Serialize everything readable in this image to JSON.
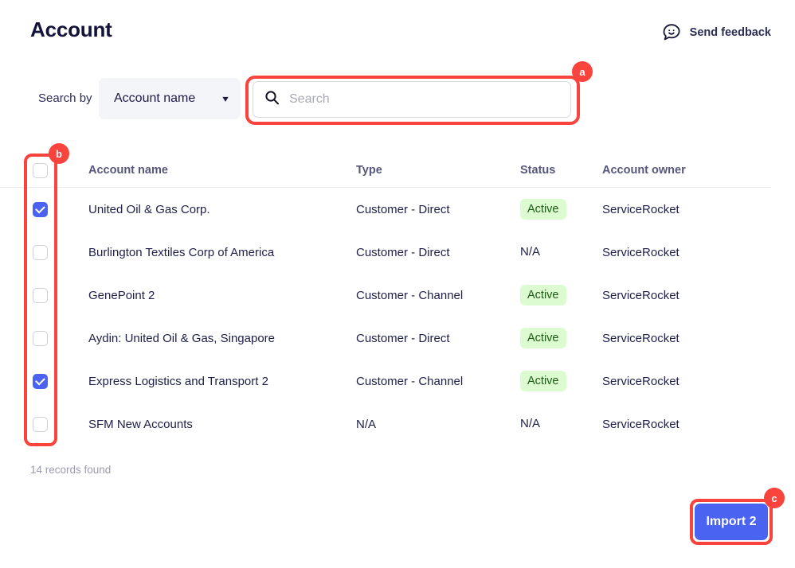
{
  "header": {
    "title": "Account",
    "feedback_label": "Send feedback",
    "feedback_icon": "speech-bubble-smiley-icon"
  },
  "search": {
    "search_by_label": "Search by",
    "selected_field": "Account name",
    "chevron_icon": "chevron-down-icon",
    "search_icon": "search-icon",
    "placeholder": "Search",
    "value": ""
  },
  "annotations": [
    {
      "id": "a",
      "target": "search-input"
    },
    {
      "id": "b",
      "target": "row-checkbox-column"
    },
    {
      "id": "c",
      "target": "import-button"
    }
  ],
  "table": {
    "columns": [
      "Account name",
      "Type",
      "Status",
      "Account owner"
    ],
    "select_all_checked": false,
    "rows": [
      {
        "checked": true,
        "name": "United Oil & Gas Corp.",
        "type": "Customer - Direct",
        "status": "Active",
        "status_style": "pill",
        "owner": "ServiceRocket"
      },
      {
        "checked": false,
        "name": "Burlington Textiles Corp of America",
        "type": "Customer - Direct",
        "status": "N/A",
        "status_style": "plain",
        "owner": "ServiceRocket"
      },
      {
        "checked": false,
        "name": "GenePoint 2",
        "type": "Customer - Channel",
        "status": "Active",
        "status_style": "pill",
        "owner": "ServiceRocket"
      },
      {
        "checked": false,
        "name": "Aydin: United Oil & Gas, Singapore",
        "type": "Customer - Direct",
        "status": "Active",
        "status_style": "pill",
        "owner": "ServiceRocket"
      },
      {
        "checked": true,
        "name": "Express Logistics and Transport 2",
        "type": "Customer - Channel",
        "status": "Active",
        "status_style": "pill",
        "owner": "ServiceRocket"
      },
      {
        "checked": false,
        "name": "SFM New Accounts",
        "type": "N/A",
        "status": "N/A",
        "status_style": "plain",
        "owner": "ServiceRocket"
      }
    ]
  },
  "footer": {
    "records_found": "14 records found",
    "import_label": "Import 2"
  },
  "colors": {
    "accent_blue": "#4a63f0",
    "highlight_red": "#f8443c",
    "status_active_bg": "#ddfbd0",
    "status_active_text": "#1d5a16",
    "title_navy": "#12123a",
    "muted_text": "#9c9cb0"
  }
}
